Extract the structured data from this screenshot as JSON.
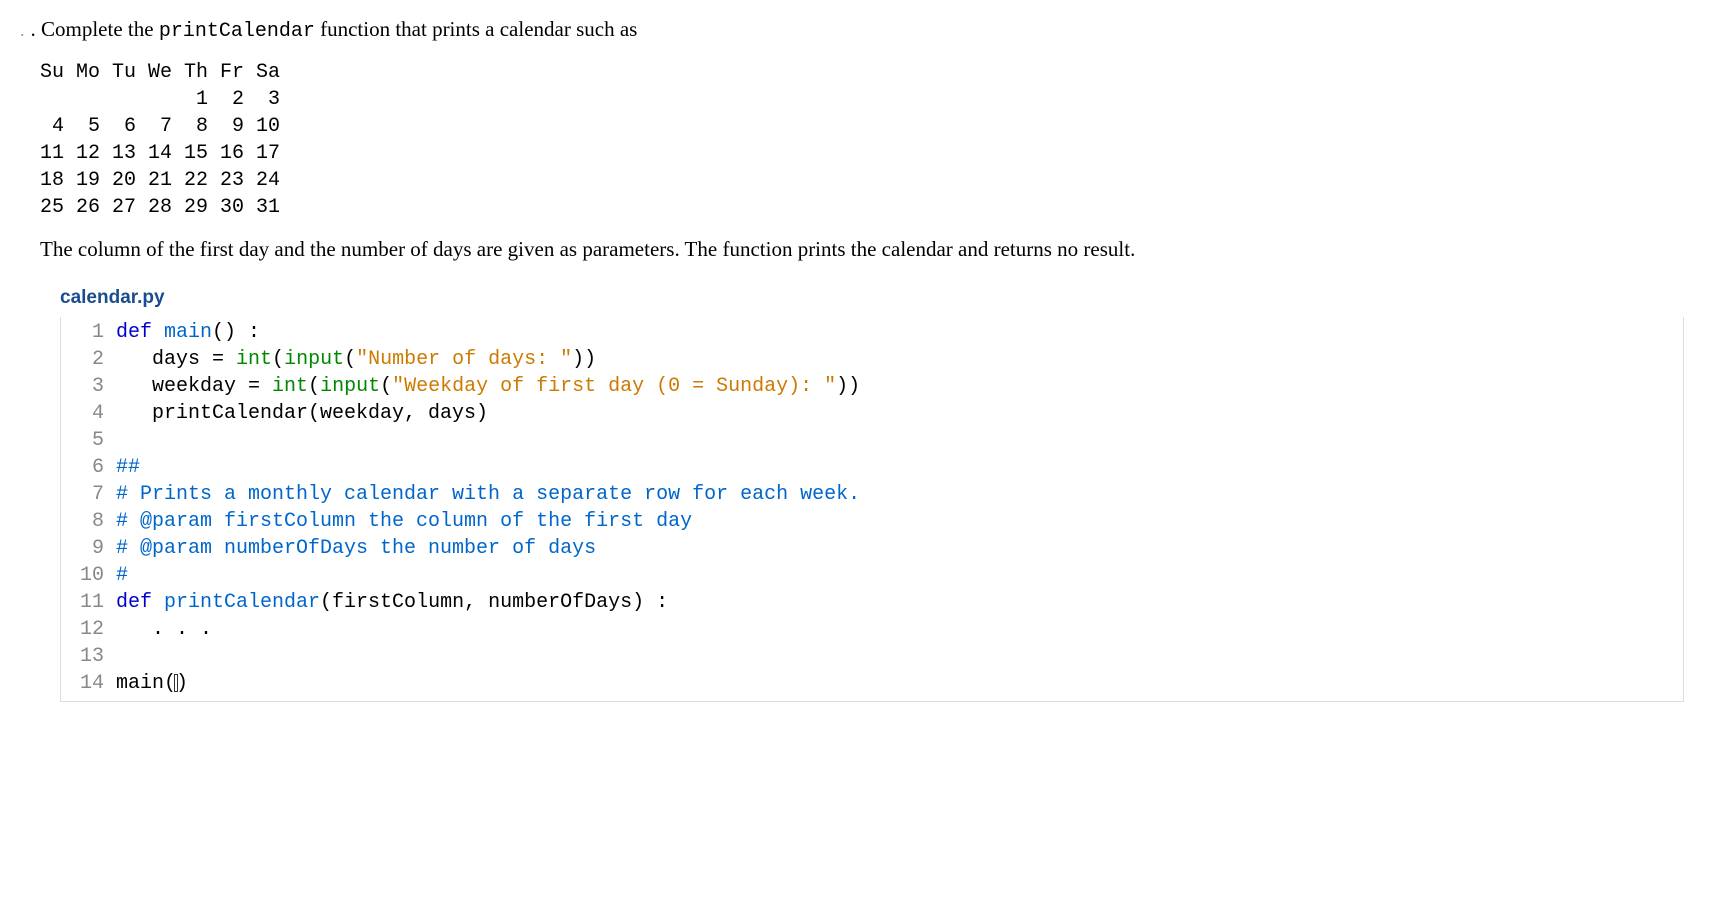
{
  "intro": {
    "prefix": ". Complete the ",
    "funcname": "printCalendar",
    "suffix": " function that prints a calendar such as"
  },
  "calendar": "Su Mo Tu We Th Fr Sa\n             1  2  3\n 4  5  6  7  8  9 10\n11 12 13 14 15 16 17\n18 19 20 21 22 23 24\n25 26 27 28 29 30 31",
  "description": "The column of the first day and the number of days are given as parameters. The function prints the calendar and returns no result.",
  "filename": "calendar.py",
  "code": {
    "lines": [
      {
        "n": "1",
        "tokens": [
          {
            "t": "def ",
            "c": "kw-def"
          },
          {
            "t": "main",
            "c": "kw-func"
          },
          {
            "t": "() :",
            "c": ""
          }
        ]
      },
      {
        "n": "2",
        "tokens": [
          {
            "t": "   days = ",
            "c": ""
          },
          {
            "t": "int",
            "c": "kw-builtin"
          },
          {
            "t": "(",
            "c": ""
          },
          {
            "t": "input",
            "c": "kw-builtin"
          },
          {
            "t": "(",
            "c": ""
          },
          {
            "t": "\"Number of days: \"",
            "c": "kw-string"
          },
          {
            "t": "))",
            "c": ""
          }
        ]
      },
      {
        "n": "3",
        "tokens": [
          {
            "t": "   weekday = ",
            "c": ""
          },
          {
            "t": "int",
            "c": "kw-builtin"
          },
          {
            "t": "(",
            "c": ""
          },
          {
            "t": "input",
            "c": "kw-builtin"
          },
          {
            "t": "(",
            "c": ""
          },
          {
            "t": "\"Weekday of first day (0 = Sunday): \"",
            "c": "kw-string"
          },
          {
            "t": "))",
            "c": ""
          }
        ]
      },
      {
        "n": "4",
        "tokens": [
          {
            "t": "   printCalendar(weekday, days)",
            "c": ""
          }
        ]
      },
      {
        "n": "5",
        "tokens": [
          {
            "t": "",
            "c": ""
          }
        ]
      },
      {
        "n": "6",
        "tokens": [
          {
            "t": "##",
            "c": "kw-comment"
          }
        ]
      },
      {
        "n": "7",
        "tokens": [
          {
            "t": "# Prints a monthly calendar with a separate row for each week.",
            "c": "kw-comment"
          }
        ]
      },
      {
        "n": "8",
        "tokens": [
          {
            "t": "# @param firstColumn the column of the first day",
            "c": "kw-comment"
          }
        ]
      },
      {
        "n": "9",
        "tokens": [
          {
            "t": "# @param numberOfDays the number of days",
            "c": "kw-comment"
          }
        ]
      },
      {
        "n": "10",
        "tokens": [
          {
            "t": "#",
            "c": "kw-comment"
          }
        ]
      },
      {
        "n": "11",
        "tokens": [
          {
            "t": "def ",
            "c": "kw-def"
          },
          {
            "t": "printCalendar",
            "c": "kw-func"
          },
          {
            "t": "(firstColumn, numberOfDays) :",
            "c": ""
          }
        ]
      },
      {
        "n": "12",
        "tokens": [
          {
            "t": "   . . .",
            "c": ""
          }
        ]
      },
      {
        "n": "13",
        "tokens": [
          {
            "t": "",
            "c": ""
          }
        ]
      },
      {
        "n": "14",
        "tokens": [
          {
            "t": "main(",
            "c": ""
          }
        ],
        "cursor": true,
        "tail": ")"
      }
    ]
  }
}
